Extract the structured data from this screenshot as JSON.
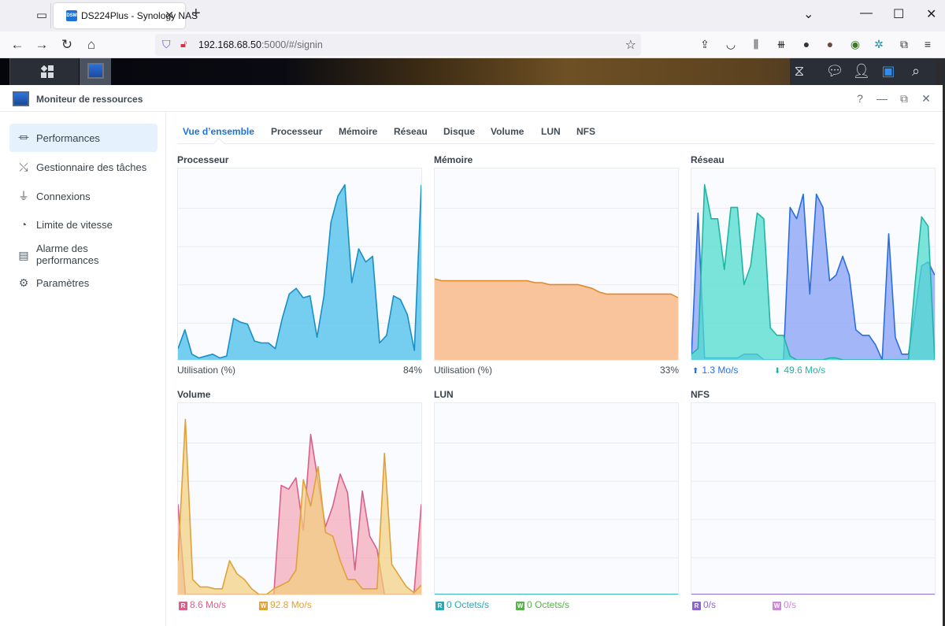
{
  "browser": {
    "tab_title": "DS224Plus - Synology NAS",
    "favicon_text": "DSM",
    "url_host": "192.168.68.50",
    "url_rest": ":5000/#/signin"
  },
  "window": {
    "title": "Moniteur de ressources",
    "help": "?"
  },
  "sidebar": {
    "items": [
      {
        "label": "Performances",
        "icon": "performance-icon",
        "glyph": "⏛",
        "active": true
      },
      {
        "label": "Gestionnaire des tâches",
        "icon": "task-manager-icon",
        "glyph": "⤯"
      },
      {
        "label": "Connexions",
        "icon": "plug-icon",
        "glyph": "⏚"
      },
      {
        "label": "Limite de vitesse",
        "icon": "gauge-icon",
        "glyph": "◔"
      },
      {
        "label": "Alarme des\nperformances",
        "icon": "alarm-list-icon",
        "glyph": "▤"
      },
      {
        "label": "Paramètres",
        "icon": "gear-icon",
        "glyph": "⚙"
      }
    ]
  },
  "tabs": [
    "Vue d’ensemble",
    "Processeur",
    "Mémoire",
    "Réseau",
    "Disque",
    "Volume",
    "LUN",
    "NFS"
  ],
  "active_tab": "Vue d’ensemble",
  "colors": {
    "accent": "#1a73d9",
    "cpu": "#1a8fc4",
    "memory": "#e08a2a",
    "net_up": "#2b6de0",
    "net_down": "#1fb5a5",
    "vol_read": "#d9608a",
    "vol_write": "#e0a13a",
    "lun_read": "#2aa9b3",
    "lun_write": "#58b04a",
    "nfs_read": "#8a64d0",
    "nfs_write": "#c98ad6"
  },
  "panels": {
    "cpu": {
      "title": "Processeur",
      "label": "Utilisation  (%)",
      "value": "84%"
    },
    "memory": {
      "title": "Mémoire",
      "label": "Utilisation  (%)",
      "value": "33%"
    },
    "network": {
      "title": "Réseau",
      "up": "1.3 Mo/s",
      "down": "49.6 Mo/s"
    },
    "volume": {
      "title": "Volume",
      "read_badge": "R",
      "read": "8.6 Mo/s",
      "write_badge": "W",
      "write": "92.8 Mo/s"
    },
    "lun": {
      "title": "LUN",
      "read_badge": "R",
      "read": "0 Octets/s",
      "write_badge": "W",
      "write": "0 Octets/s"
    },
    "nfs": {
      "title": "NFS",
      "read_badge": "R",
      "read": "0/s",
      "write_badge": "W",
      "write": "0/s"
    }
  },
  "chart_data": [
    {
      "type": "area",
      "title": "Processeur",
      "ylim": [
        0,
        100
      ],
      "series": [
        {
          "name": "Utilisation",
          "values": [
            6,
            16,
            3,
            1,
            2,
            3,
            1,
            2,
            22,
            20,
            19,
            10,
            9,
            9,
            6,
            22,
            35,
            38,
            33,
            34,
            12,
            34,
            73,
            87,
            93,
            41,
            59,
            52,
            55,
            9,
            13,
            34,
            32,
            24,
            5,
            93
          ]
        }
      ]
    },
    {
      "type": "area",
      "title": "Mémoire",
      "ylim": [
        0,
        100
      ],
      "series": [
        {
          "name": "Utilisation",
          "values": [
            43,
            42,
            42,
            42,
            42,
            42,
            42,
            42,
            42,
            42,
            42,
            42,
            42,
            42,
            41,
            41,
            40,
            40,
            40,
            40,
            40,
            39,
            38,
            36,
            35,
            35,
            35,
            35,
            35,
            35,
            35,
            35,
            35,
            35,
            33
          ]
        }
      ]
    },
    {
      "type": "area",
      "title": "Réseau",
      "ylim": [
        0,
        100
      ],
      "series": [
        {
          "name": "Envoi",
          "values": [
            3,
            6,
            93,
            75,
            75,
            48,
            81,
            81,
            40,
            50,
            78,
            75,
            17,
            13,
            13,
            2,
            0,
            0,
            0,
            0,
            0,
            1,
            1,
            0,
            0,
            0,
            0,
            0,
            0,
            0,
            0,
            0,
            0,
            0,
            40,
            76,
            71,
            0
          ]
        },
        {
          "name": "Réception",
          "values": [
            2,
            78,
            1,
            1,
            1,
            1,
            1,
            1,
            3,
            3,
            3,
            0,
            0,
            0,
            0,
            81,
            75,
            88,
            35,
            88,
            81,
            42,
            45,
            55,
            45,
            16,
            13,
            13,
            8,
            0,
            67,
            12,
            3,
            3,
            25,
            50,
            52,
            45
          ]
        }
      ]
    },
    {
      "type": "area",
      "title": "Volume",
      "ylim": [
        0,
        100
      ],
      "series": [
        {
          "name": "Lecture",
          "values": [
            18,
            93,
            8,
            4,
            4,
            3,
            3,
            18,
            11,
            8,
            3,
            0,
            0,
            3,
            5,
            7,
            13,
            61,
            47,
            68,
            33,
            31,
            18,
            8,
            8,
            3,
            3,
            3,
            75,
            16,
            10,
            4,
            1,
            5
          ]
        },
        {
          "name": "Écriture",
          "values": [
            48,
            0,
            0,
            0,
            0,
            0,
            0,
            0,
            0,
            0,
            0,
            0,
            0,
            0,
            58,
            56,
            62,
            34,
            85,
            60,
            36,
            47,
            64,
            54,
            13,
            55,
            31,
            24,
            0,
            0,
            0,
            0,
            0,
            48
          ]
        }
      ]
    },
    {
      "type": "area",
      "title": "LUN",
      "ylim": [
        0,
        100
      ],
      "series": [
        {
          "name": "Lecture",
          "values": [
            0
          ]
        },
        {
          "name": "Écriture",
          "values": [
            0
          ]
        }
      ]
    },
    {
      "type": "area",
      "title": "NFS",
      "ylim": [
        0,
        100
      ],
      "series": [
        {
          "name": "Lecture",
          "values": [
            0
          ]
        },
        {
          "name": "Écriture",
          "values": [
            0
          ]
        }
      ]
    }
  ]
}
